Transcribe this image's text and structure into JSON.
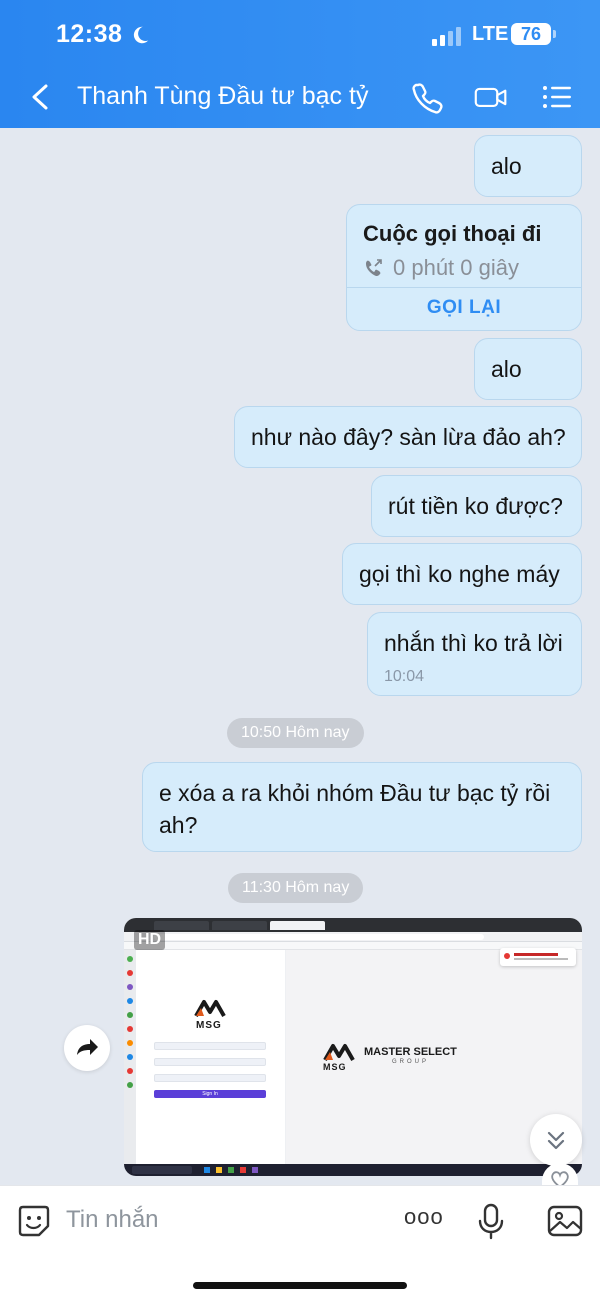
{
  "status_bar": {
    "time": "12:38",
    "network": "LTE",
    "battery": "76"
  },
  "header": {
    "title": "Thanh Tùng Đầu tư bạc tỷ"
  },
  "messages": {
    "m1": "alo",
    "call": {
      "title": "Cuộc gọi thoại đi",
      "duration": "0 phút 0 giây",
      "action": "GỌI LẠI"
    },
    "m2": "alo",
    "m3": "như nào đây? sàn lừa đảo ah?",
    "m4": "rút tiền ko được?",
    "m5": "gọi thì ko nghe máy",
    "m6": "nhắn thì ko trả lời",
    "m6_time": "10:04",
    "date1": "10:50 Hôm nay",
    "m7": "e xóa a ra khỏi nhóm Đầu tư bạc tỷ rồi ah?",
    "date2": "11:30 Hôm nay"
  },
  "image_message": {
    "badge": "HD",
    "logo_text": "MSG",
    "brand_name": "MASTER SELECT",
    "brand_sub": "GROUP",
    "signin_label": "Sign In"
  },
  "composer": {
    "placeholder": "Tin nhắn",
    "more": "ooo"
  },
  "colors": {
    "header": "#2f8df3",
    "bubble": "#d6ecfb",
    "accent": "#2f8df3",
    "background": "#e3e8f0"
  }
}
